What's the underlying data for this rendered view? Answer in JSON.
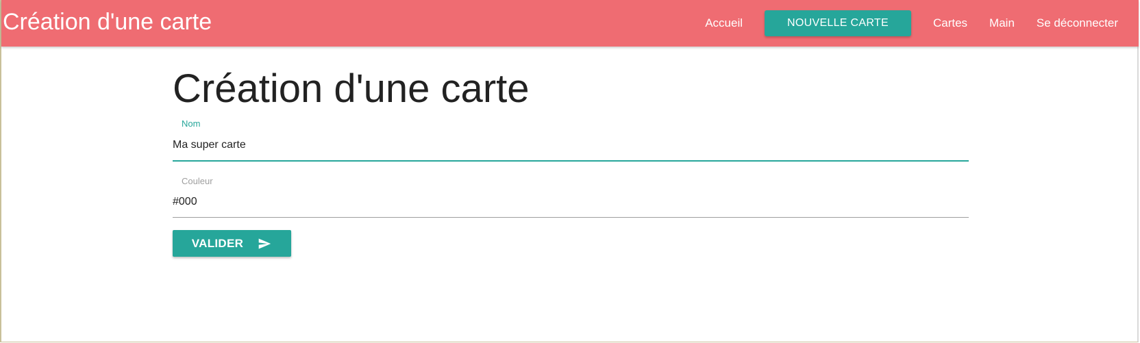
{
  "navbar": {
    "brand": "Création d'une carte",
    "links": {
      "accueil": "Accueil",
      "nouvelle_carte": "NOUVELLE CARTE",
      "cartes": "Cartes",
      "main": "Main",
      "deconnexion": "Se déconnecter"
    },
    "background_color": "#ef6c72"
  },
  "main": {
    "title": "Création d'une carte",
    "form": {
      "nom": {
        "label": "Nom",
        "value": "Ma super carte"
      },
      "couleur": {
        "label": "Couleur",
        "value": "#000"
      },
      "submit_label": "VALIDER",
      "submit_icon": "send-icon"
    }
  },
  "colors": {
    "accent": "#26a69a",
    "text": "#222222",
    "muted": "#9e9e9e"
  }
}
